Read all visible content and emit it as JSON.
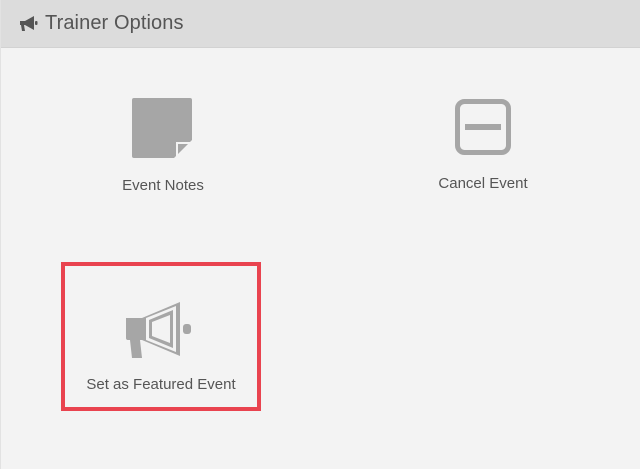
{
  "header": {
    "title": "Trainer Options",
    "icon": "megaphone-icon"
  },
  "options": [
    {
      "label": "Event Notes",
      "icon": "note-icon"
    },
    {
      "label": "Cancel Event",
      "icon": "minus-square-icon"
    },
    {
      "label": "Set as Featured Event",
      "icon": "megaphone-icon",
      "highlighted": true
    }
  ],
  "colors": {
    "header_bg": "#dcdcdc",
    "panel_bg": "#f3f3f3",
    "icon": "#a6a6a6",
    "text": "#555555",
    "highlight_border": "#e9434f"
  }
}
